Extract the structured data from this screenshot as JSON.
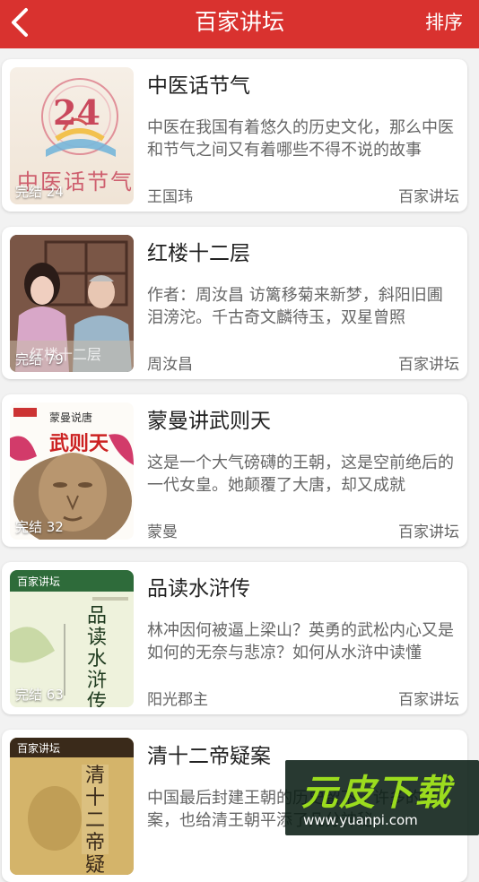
{
  "header": {
    "title": "百家讲坛",
    "sort_label": "排序",
    "accent": "#d9322f"
  },
  "books": [
    {
      "title": "中医话节气",
      "description": "中医在我国有着悠久的历史文化，那么中医和节气之间又有着哪些不得不说的故事",
      "author": "王国玮",
      "source": "百家讲坛",
      "status": "完结 24",
      "cover_text": "中医话节气",
      "cover_number": "24"
    },
    {
      "title": "红楼十二层",
      "description": "作者：周汝昌 访篱移菊来新梦，斜阳旧圃泪滂沱。千古奇文麟待玉，双星曾照",
      "author": "周汝昌",
      "source": "百家讲坛",
      "status": "完结 79",
      "cover_text": "红楼十二层"
    },
    {
      "title": "蒙曼讲武则天",
      "description": "这是一个大气磅礴的王朝，这是空前绝后的一代女皇。她颠覆了大唐，却又成就",
      "author": "蒙曼",
      "source": "百家讲坛",
      "status": "完结 32",
      "cover_text": "武则天",
      "cover_subtext": "蒙曼说唐"
    },
    {
      "title": "品读水浒传",
      "description": "林冲因何被逼上梁山？英勇的武松内心又是如何的无奈与悲凉？如何从水浒中读懂",
      "author": "阳光郡主",
      "source": "百家讲坛",
      "status": "完结 63",
      "cover_text": "品读水浒传",
      "cover_subtext": "百家讲坛"
    },
    {
      "title": "清十二帝疑案",
      "description": "中国最后封建王朝的历史留下了许多的疑案，也给清王朝平添了几分神秘",
      "author": "",
      "source": "",
      "status": "",
      "cover_text": "清十二帝疑案",
      "cover_subtext": "百家讲坛"
    }
  ],
  "watermark": {
    "logo": "元皮下载",
    "url": "www.yuanpi.com"
  }
}
